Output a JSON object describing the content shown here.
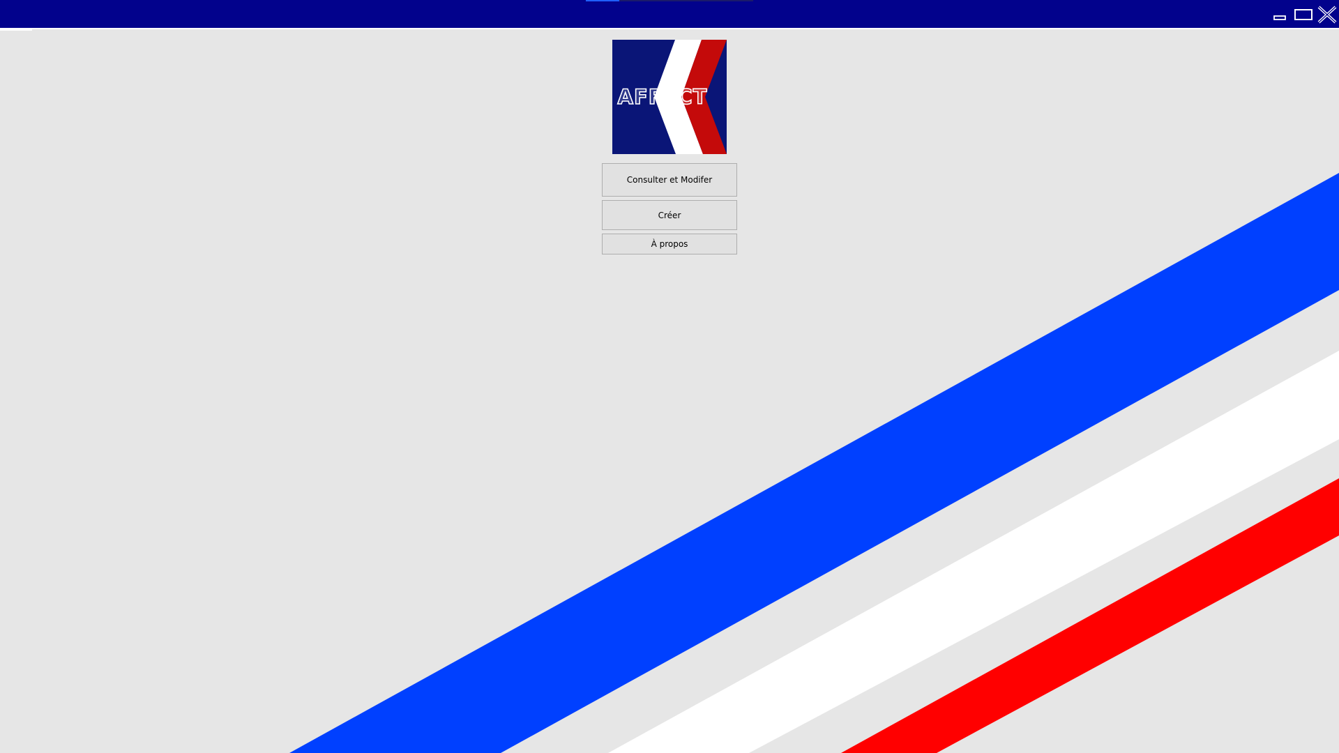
{
  "app": {
    "logo_text": "AFFECT"
  },
  "titlebar": {
    "minimize_icon": "minimize-icon",
    "maximize_icon": "maximize-icon",
    "close_icon": "close-icon"
  },
  "menu": {
    "consult_label": "Consulter et Modifer",
    "create_label": "Créer",
    "about_label": "À propos"
  },
  "colors": {
    "titlebar": "#02028c",
    "background": "#e6e6e6",
    "stripe_blue": "#0040ff",
    "stripe_white": "#ffffff",
    "stripe_red": "#ff0000",
    "logo_blue": "#0a1577",
    "logo_red": "#c40a0a"
  }
}
